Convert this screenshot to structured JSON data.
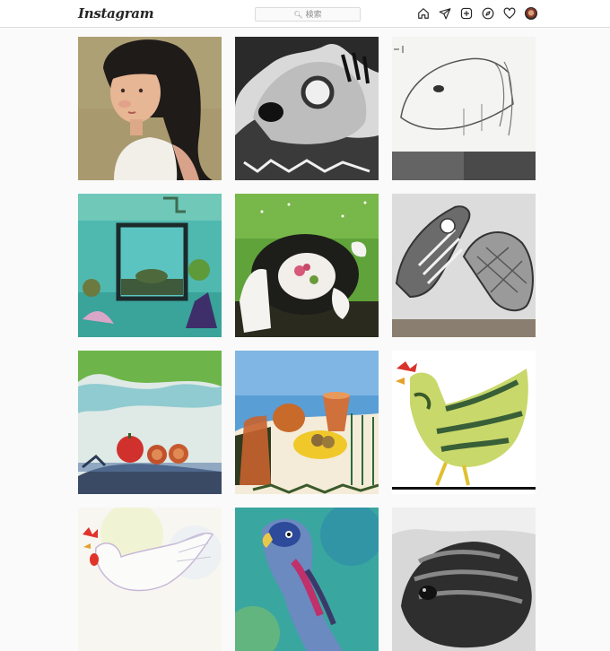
{
  "header": {
    "logo_text": "Instagram",
    "search_placeholder": "検索",
    "icons": [
      "home-icon",
      "direct-message-icon",
      "new-post-icon",
      "explore-icon",
      "activity-heart-icon",
      "profile-avatar"
    ]
  },
  "colors": {
    "background": "#fafafa",
    "topbar": "#ffffff",
    "border": "#dbdbdb",
    "text": "#262626",
    "placeholder": "#8e8e8e"
  },
  "posts": [
    {
      "name": "post-girl-portrait"
    },
    {
      "name": "post-charcoal-creature"
    },
    {
      "name": "post-pencil-fish-sketch"
    },
    {
      "name": "post-aquarium-painting"
    },
    {
      "name": "post-turtle-painting"
    },
    {
      "name": "post-sneakers-drawing"
    },
    {
      "name": "post-fruit-still-life"
    },
    {
      "name": "post-pots-still-life"
    },
    {
      "name": "post-rooster-painting"
    },
    {
      "name": "post-white-bird-watercolor"
    },
    {
      "name": "post-parrot-watercolor"
    },
    {
      "name": "post-charcoal-animal"
    }
  ]
}
